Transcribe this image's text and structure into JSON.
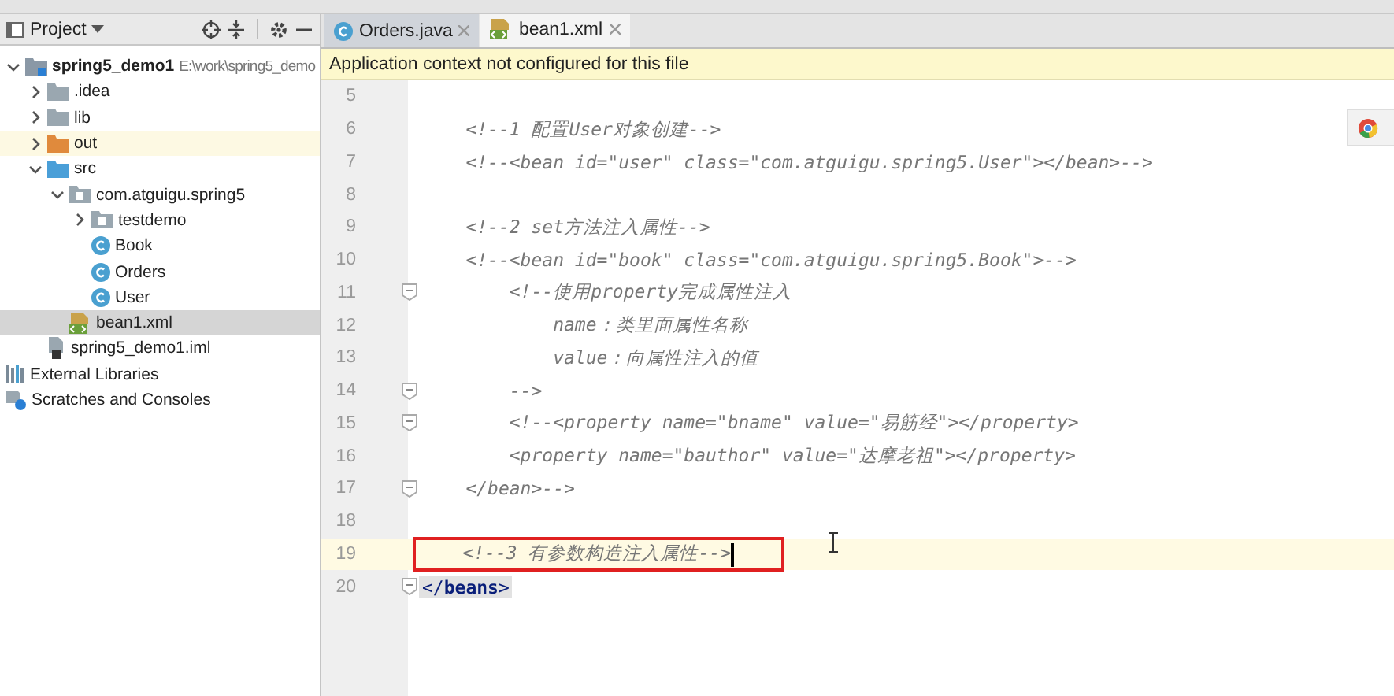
{
  "project_panel": {
    "title": "Project",
    "tree": [
      {
        "label": "spring5_demo1",
        "path": "E:\\work\\spring5_demo",
        "kind": "project",
        "expanded": true,
        "selected": false,
        "children": [
          {
            "label": ".idea",
            "kind": "folder",
            "expanded": false,
            "selected": false
          },
          {
            "label": "lib",
            "kind": "folder",
            "expanded": false,
            "selected": false
          },
          {
            "label": "out",
            "kind": "excluded",
            "expanded": false,
            "selected": false,
            "hovered": true
          },
          {
            "label": "src",
            "kind": "source",
            "expanded": true,
            "selected": false,
            "children": [
              {
                "label": "com.atguigu.spring5",
                "kind": "package",
                "expanded": true,
                "selected": false,
                "children": [
                  {
                    "label": "testdemo",
                    "kind": "package",
                    "expanded": false,
                    "selected": false
                  },
                  {
                    "label": "Book",
                    "kind": "class",
                    "selected": false
                  },
                  {
                    "label": "Orders",
                    "kind": "class",
                    "selected": false
                  },
                  {
                    "label": "User",
                    "kind": "class",
                    "selected": false
                  }
                ]
              },
              {
                "label": "bean1.xml",
                "kind": "xml",
                "selected": true
              }
            ]
          },
          {
            "label": "spring5_demo1.iml",
            "kind": "iml",
            "selected": false
          }
        ]
      },
      {
        "label": "External Libraries",
        "kind": "libraries",
        "selected": false
      },
      {
        "label": "Scratches and Consoles",
        "kind": "scratches",
        "selected": false
      }
    ]
  },
  "editor": {
    "tabs": [
      {
        "label": "Orders.java",
        "kind": "class",
        "selected": false
      },
      {
        "label": "bean1.xml",
        "kind": "xml",
        "selected": true
      }
    ],
    "banner": "Application context not configured for this file",
    "lines": [
      {
        "number": "5"
      },
      {
        "number": "6",
        "text": "    <!--1 配置User对象创建-->",
        "kind": "comment"
      },
      {
        "number": "7",
        "text": "    <!--<bean id=\"user\" class=\"com.atguigu.spring5.User\"></bean>-->",
        "kind": "comment"
      },
      {
        "number": "8"
      },
      {
        "number": "9",
        "text": "    <!--2 set方法注入属性-->",
        "kind": "comment"
      },
      {
        "number": "10",
        "text": "    <!--<bean id=\"book\" class=\"com.atguigu.spring5.Book\">-->",
        "kind": "comment"
      },
      {
        "number": "11",
        "text": "        <!--使用property完成属性注入",
        "kind": "comment",
        "fold": true
      },
      {
        "number": "12",
        "text": "            name：类里面属性名称",
        "kind": "comment"
      },
      {
        "number": "13",
        "text": "            value：向属性注入的值",
        "kind": "comment"
      },
      {
        "number": "14",
        "text": "        -->",
        "kind": "comment",
        "fold": true
      },
      {
        "number": "15",
        "text": "        <!--<property name=\"bname\" value=\"易筋经\"></property>",
        "kind": "comment",
        "fold": true
      },
      {
        "number": "16",
        "text": "        <property name=\"bauthor\" value=\"达摩老祖\"></property>",
        "kind": "comment"
      },
      {
        "number": "17",
        "text": "    </bean>-->",
        "kind": "comment",
        "fold": true
      },
      {
        "number": "18"
      },
      {
        "number": "19",
        "text": "    <!--3 有参数构造注入属性-->",
        "kind": "comment",
        "current": true,
        "boxed": true
      },
      {
        "number": "20",
        "text": "</**beans**>",
        "kind": "tag",
        "fold": true
      }
    ]
  }
}
